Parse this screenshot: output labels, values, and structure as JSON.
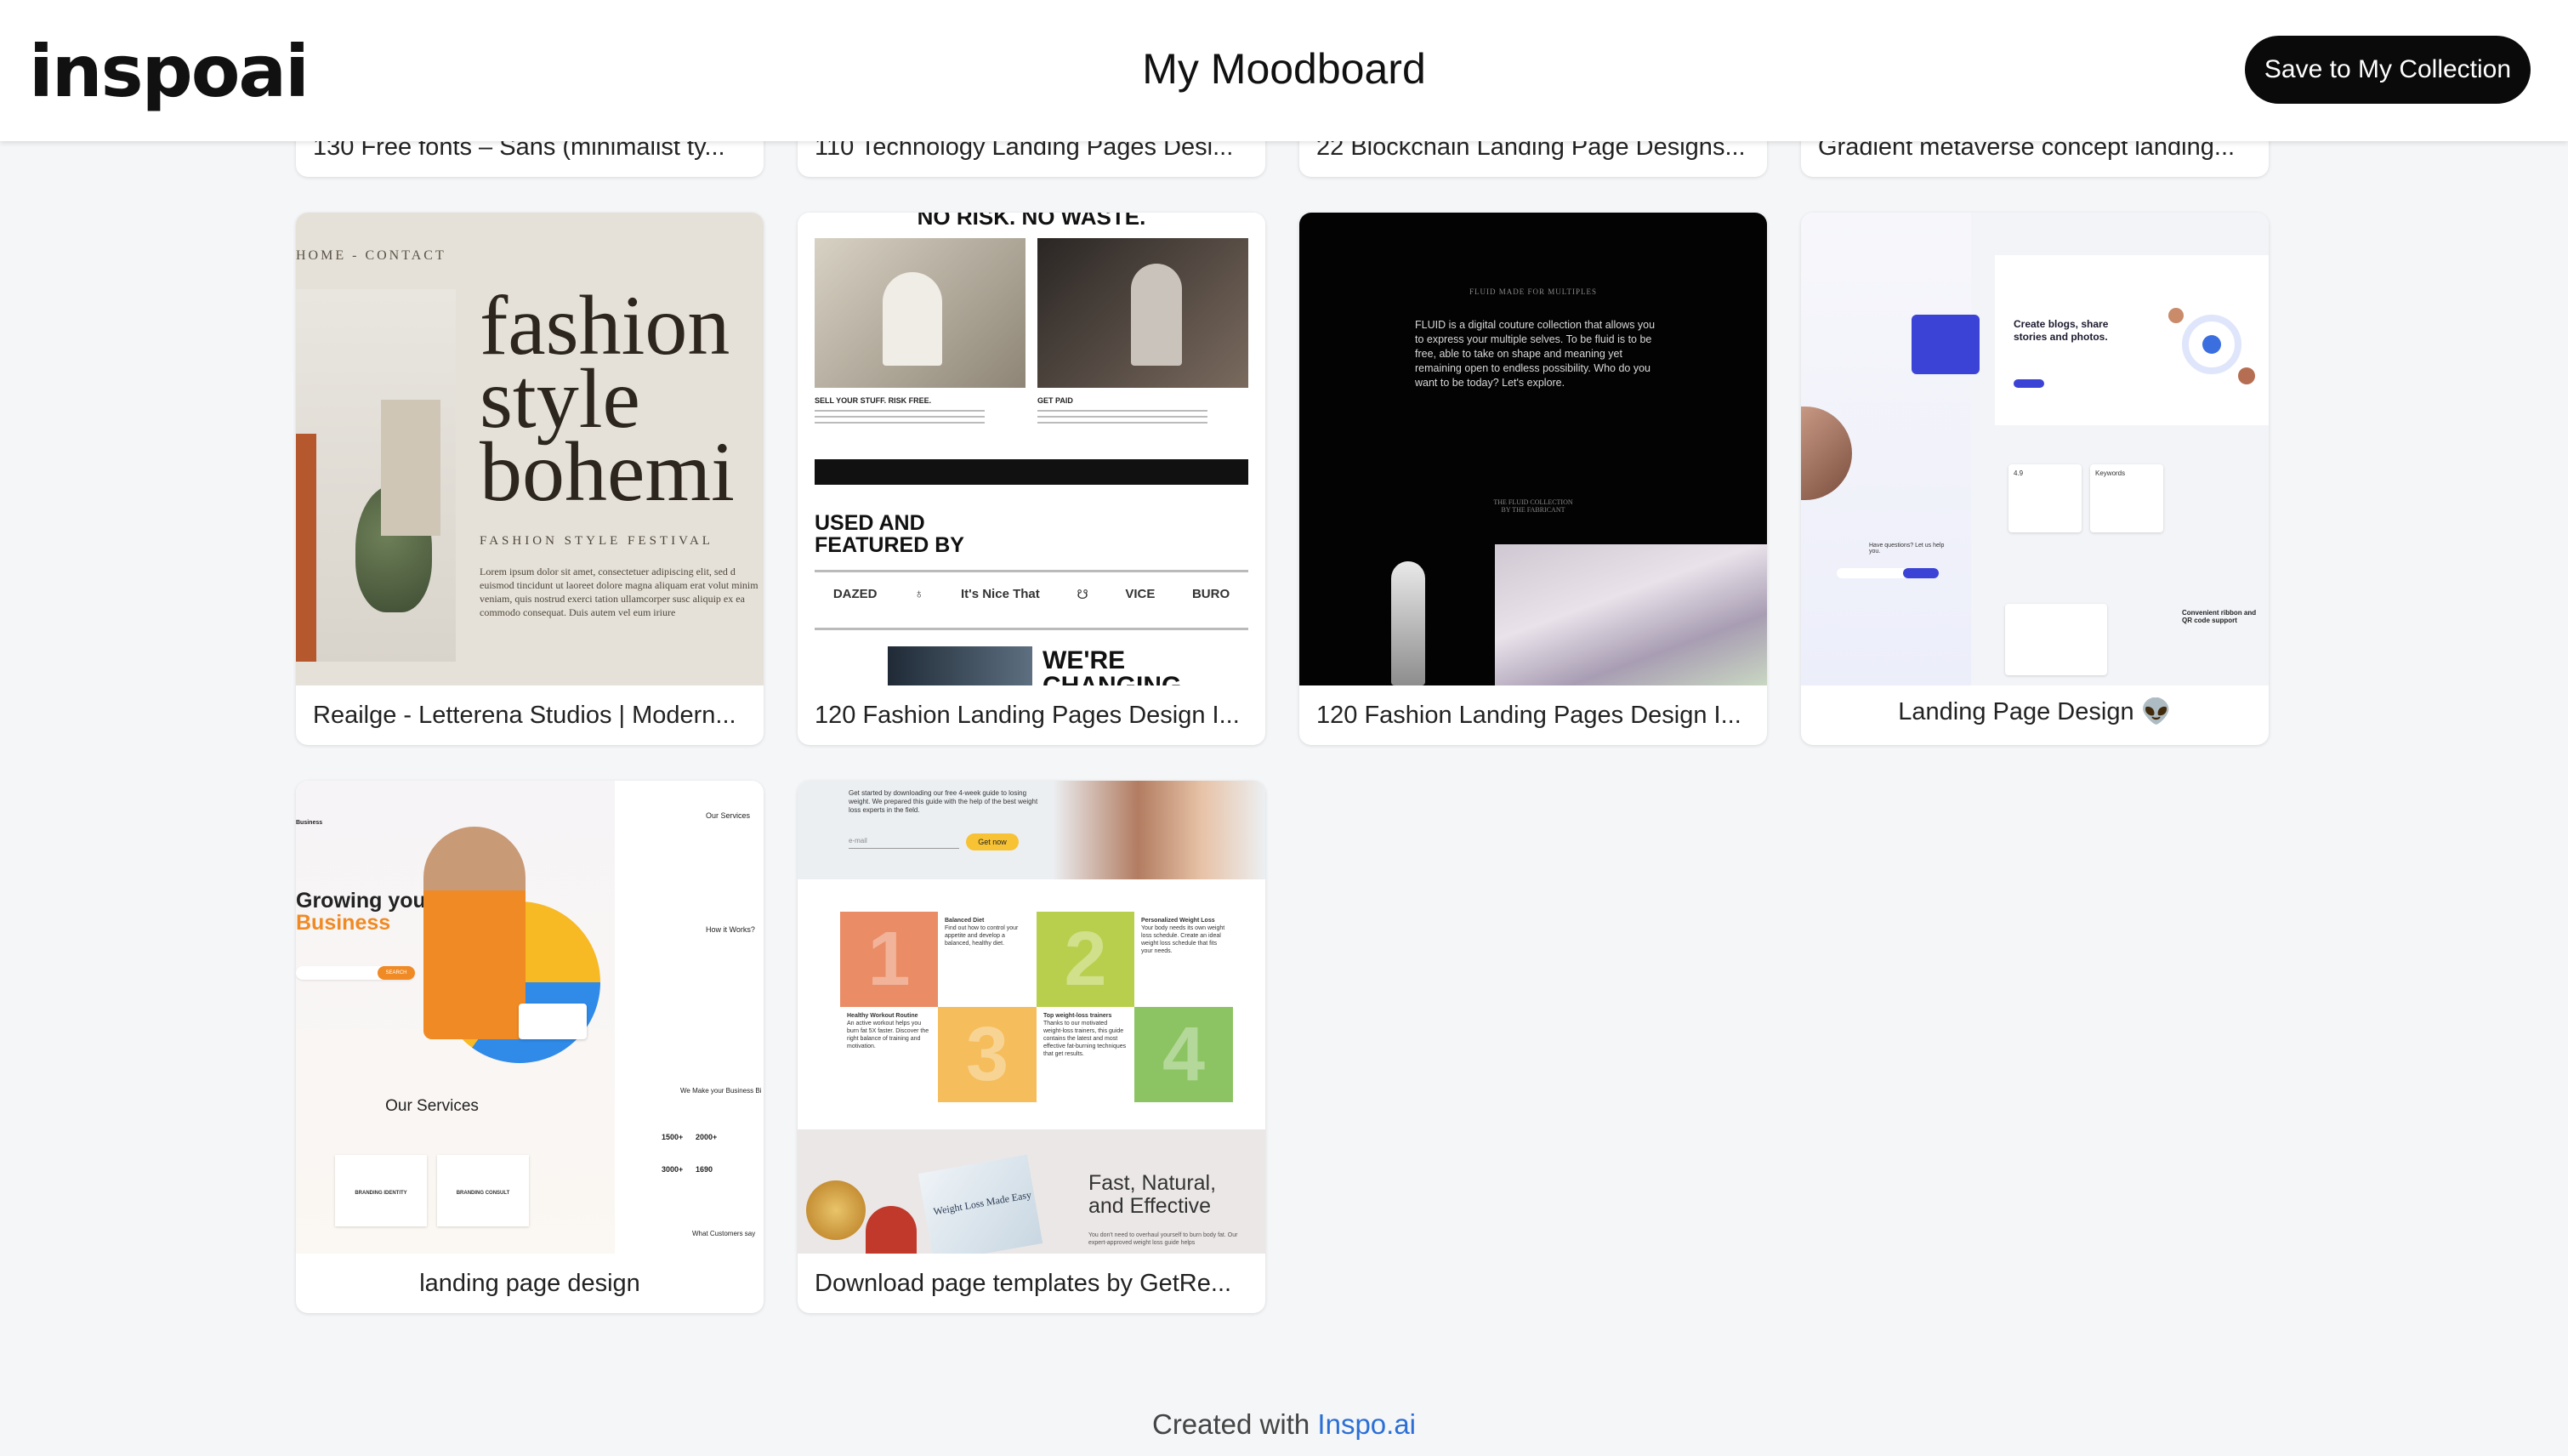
{
  "header": {
    "logo_text": "inspoai",
    "title": "My Moodboard",
    "save_label": "Save to My Collection"
  },
  "top_row": [
    {
      "caption": "130 Free fonts – Sans (minimalist ty..."
    },
    {
      "caption": "110 Technology Landing Pages Desi..."
    },
    {
      "caption": "22 Blockchain Landing Page Designs..."
    },
    {
      "caption": "Gradient metaverse concept landing..."
    }
  ],
  "cards": [
    {
      "caption": "Reailge - Letterena Studios | Modern...",
      "thumb": {
        "nav": "HOME  -  CONTACT",
        "headline": [
          "fashion",
          "style",
          "bohemi"
        ],
        "subtitle": "FASHION STYLE FESTIVAL",
        "body": "Lorem ipsum dolor sit amet, consectetuer adipiscing elit, sed d euismod tincidunt ut laoreet dolore magna aliquam erat volut minim veniam, quis nostrud exerci tation ullamcorper susc aliquip ex ea commodo consequat. Duis autem vel eum iriure"
      }
    },
    {
      "caption": "120 Fashion Landing Pages Design I...",
      "thumb": {
        "top": "NO RISK. NO WASTE.",
        "left_label": "SELL YOUR STUFF. RISK FREE.",
        "right_label": "GET PAID",
        "featured": "USED AND\nFEATURED BY",
        "logos": [
          "DAZED",
          "♁",
          "It's Nice That",
          "☋",
          "VICE",
          "BURO"
        ],
        "bottom": "WE'RE\nCHANGING"
      }
    },
    {
      "caption": "120 Fashion Landing Pages Design I...",
      "thumb": {
        "eyebrow": "FLUID MADE FOR MULTIPLES",
        "text": "FLUID is a digital couture collection that allows you to express your multiple selves. To be fluid is to be free, able to take on shape and meaning yet remaining open to endless possibility. Who do you want to be today? Let's explore.",
        "sub": "THE FLUID COLLECTION\nBY THE FABRICANT"
      }
    },
    {
      "caption": "Landing Page Design 👽",
      "thumb": {
        "headline": "Create blogs, share stories and photos.",
        "q": "Have questions? Let us help you.",
        "card1": "4.9",
        "card2": "Keywords",
        "scan": "Convenient ribbon and QR code support"
      }
    },
    {
      "caption": "landing page design",
      "thumb": {
        "brand": "Business",
        "headline1": "Growing your",
        "headline2": "Business",
        "services": "Our Services",
        "side_services": "Our Services",
        "how": "How it Works?",
        "make": "We Make your Business Bi",
        "stats": [
          "1500+",
          "2000+",
          "3000+",
          "1690"
        ],
        "cards": [
          "BRANDING IDENTITY",
          "BRANDING CONSULT"
        ],
        "customers": "What Customers say",
        "cta": "SEARCH"
      }
    },
    {
      "caption": "Download page templates by GetRe...",
      "thumb": {
        "intro": "Get started by downloading our free 4-week guide to losing weight. We prepared this guide with the help of the best weight loss experts in the field.",
        "email": "e-mail",
        "btn": "Get now",
        "tiles": [
          {
            "num": "1",
            "title": "Balanced Diet",
            "text": "Find out how to control your appetite and develop a balanced, healthy diet."
          },
          {
            "num": "2",
            "title": "Personalized Weight Loss",
            "text": "Your body needs its own weight loss schedule. Create an ideal weight loss schedule that fits your needs."
          },
          {
            "num": "3",
            "title": "Healthy Workout Routine",
            "text": "An active workout helps you burn fat 5X faster. Discover the right balance of training and motivation."
          },
          {
            "num": "4",
            "title": "Top weight-loss trainers",
            "text": "Thanks to our motivated weight-loss trainers, this guide contains the latest and most effective fat-burning techniques that get results."
          }
        ],
        "promo1": "Fast, Natural,",
        "promo2": "and Effective",
        "book": "Weight Loss Made Easy",
        "promo_small": "You don't need to overhaul yourself to burn body fat. Our expert-approved weight loss guide helps"
      }
    }
  ],
  "footer": {
    "prefix": "Created with ",
    "link": "Inspo.ai"
  },
  "colors": {
    "accent": "#2b6fd6",
    "button": "#0a0a0a",
    "background": "#f4f6f8"
  }
}
